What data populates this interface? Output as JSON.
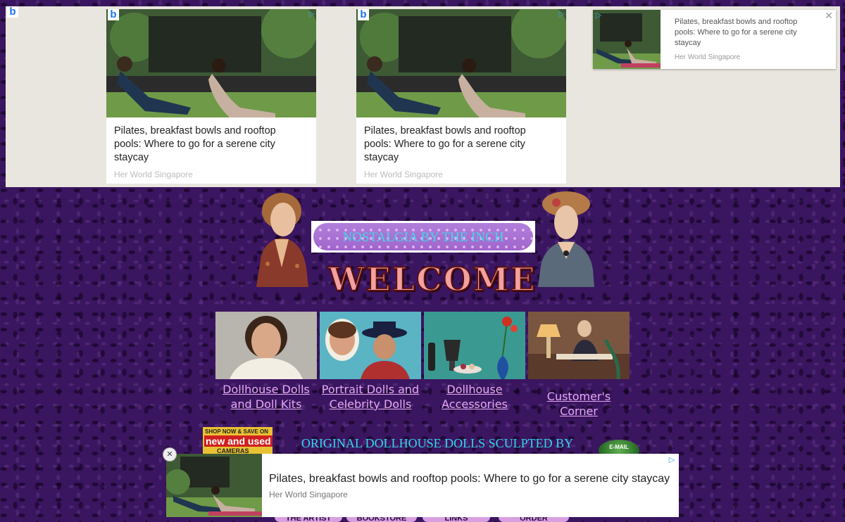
{
  "top_ads": {
    "cards": [
      {
        "title": "Pilates, breakfast bowls and rooftop pools: Where to go for a serene city staycay",
        "source": "Her World Singapore"
      },
      {
        "title": "Pilates, breakfast bowls and rooftop pools: Where to go for a serene city staycay",
        "source": "Her World Singapore"
      }
    ],
    "side": {
      "title": "Pilates, breakfast bowls and rooftop pools: Where to go for a serene city staycay",
      "source": "Her World Singapore",
      "close": "✕"
    },
    "brand_glyph": "b",
    "adchoice_glyph": "▷"
  },
  "header": {
    "logo_text": "NOSTALGIA BY THE INCH",
    "welcome": "WELCOME"
  },
  "categories": [
    {
      "line1": "Dollhouse Dolls",
      "line2": "and Doll Kits"
    },
    {
      "line1": "Portrait Dolls and",
      "line2": "Celebrity Dolls"
    },
    {
      "line1": "Dollhouse",
      "line2": "Accessories"
    },
    {
      "line1": "Customer's Corner",
      "line2": ""
    }
  ],
  "section": {
    "heading": "ORIGINAL DOLLHOUSE DOLLS SCULPTED BY",
    "camera_banner": {
      "line1": "SHOP NOW & SAVE ON",
      "line2": "new and used",
      "line3": "CAMERAS"
    },
    "email_label": "E-MAIL"
  },
  "bottom_tabs": [
    "THE ARTIST",
    "BOOKSTORE",
    "LINKS",
    "ORDER"
  ],
  "bottom_ad": {
    "title": "Pilates, breakfast bowls and rooftop pools: Where to go for a serene city staycay",
    "source": "Her World Singapore",
    "close": "✕",
    "adchoice_glyph": "▷"
  },
  "colors": {
    "background": "#3a1560",
    "link": "#e4a9f2",
    "heading": "#34d6ea",
    "welcome": "#f2a0a0"
  }
}
